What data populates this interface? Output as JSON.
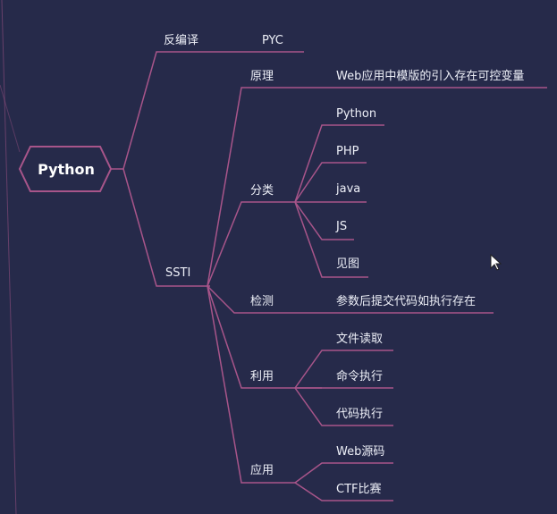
{
  "colors": {
    "background": "#262a4a",
    "line": "#a8558a",
    "text": "#eef0f8",
    "root_border": "#a8558a"
  },
  "root": {
    "label": "Python"
  },
  "branches": {
    "decompile": {
      "label": "反编译",
      "children": [
        "PYC"
      ]
    },
    "ssti": {
      "label": "SSTI",
      "principle": {
        "label": "原理",
        "detail": "Web应用中模版的引入存在可控变量"
      },
      "classification": {
        "label": "分类",
        "children": [
          "Python",
          "PHP",
          "java",
          "JS",
          "见图"
        ]
      },
      "detection": {
        "label": "检测",
        "detail": "参数后提交代码如执行存在"
      },
      "exploitation": {
        "label": "利用",
        "children": [
          "文件读取",
          "命令执行",
          "代码执行"
        ]
      },
      "application": {
        "label": "应用",
        "children": [
          "Web源码",
          "CTF比赛"
        ]
      }
    }
  }
}
